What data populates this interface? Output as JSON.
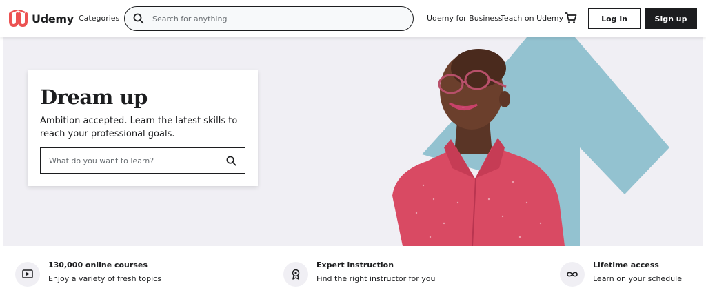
{
  "header": {
    "logo_text": "Udemy",
    "categories": "Categories",
    "search_placeholder": "Search for anything",
    "business_link": "Udemy for Business",
    "teach_link": "Teach on Udemy",
    "login_label": "Log in",
    "signup_label": "Sign up"
  },
  "hero": {
    "title": "Dream up",
    "subtitle": "Ambition accepted. Learn the latest skills to reach your professional goals.",
    "search_placeholder": "What do you want to learn?"
  },
  "features": [
    {
      "icon": "play-video-icon",
      "title": "130,000 online courses",
      "subtitle": "Enjoy a variety of fresh topics"
    },
    {
      "icon": "award-ribbon-icon",
      "title": "Expert instruction",
      "subtitle": "Find the right instructor for you"
    },
    {
      "icon": "infinity-icon",
      "title": "Lifetime access",
      "subtitle": "Learn on your schedule"
    }
  ],
  "colors": {
    "brand_accent": "#ec5252",
    "dark": "#1c1d1f",
    "hero_bg": "#f0eff4",
    "arrow_blue": "#8dbfcd",
    "shirt_red": "#d94a63"
  }
}
